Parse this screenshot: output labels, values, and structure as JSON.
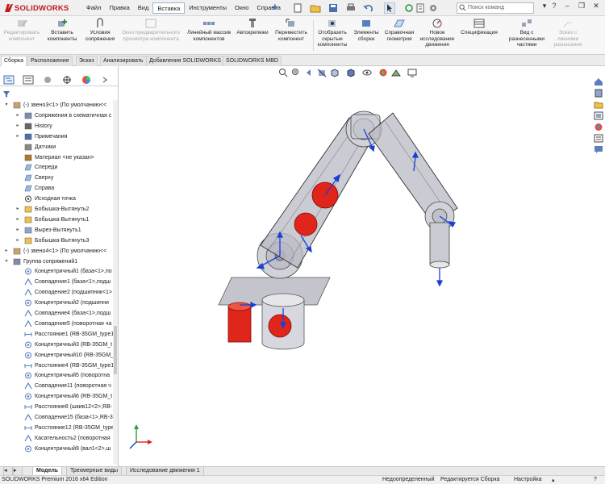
{
  "app": {
    "logo_text": "SOLIDWORKS",
    "brand_color": "#c0181f",
    "menu": [
      "Файл",
      "Правка",
      "Вид",
      "Вставка",
      "Инструменты",
      "Окно",
      "Справка"
    ],
    "active_menu": "Вставка",
    "search_placeholder": "Поиск команд"
  },
  "ribbon": {
    "buttons": [
      {
        "label": "Редактировать компонент",
        "disabled": true
      },
      {
        "label": "Вставить компоненты",
        "disabled": false
      },
      {
        "label": "Условия сопряжения",
        "disabled": false
      },
      {
        "label": "Окно предварительного просмотра компонента",
        "disabled": true
      },
      {
        "label": "Линейный массив компонентов",
        "disabled": false
      },
      {
        "label": "Автокрепежи",
        "disabled": false
      },
      {
        "label": "Переместить компонент",
        "disabled": false
      },
      {
        "label": "Отобразить скрытые компоненты",
        "disabled": false
      },
      {
        "label": "Элементы сборки",
        "disabled": false
      },
      {
        "label": "Справочная геометрия",
        "disabled": false
      },
      {
        "label": "Новое исследование движения",
        "disabled": false
      },
      {
        "label": "Спецификация",
        "disabled": false
      },
      {
        "label": "Вид с разнесенными частями",
        "disabled": false
      },
      {
        "label": "Эскиз с линиями разнесения",
        "disabled": true
      }
    ]
  },
  "command_tabs": [
    "Сборка",
    "Расположение",
    "Эскиз",
    "Анализировать",
    "Добавления SOLIDWORKS",
    "SOLIDWORKS MBD"
  ],
  "active_command_tab": "Сборка",
  "tree": {
    "items": [
      {
        "label": "(-) звено3<1> (По умолчанию<<",
        "icon": "part-icon",
        "indent": 0,
        "expander": "▾"
      },
      {
        "label": "Сопряжения в схематичная с",
        "icon": "mates-icon",
        "indent": 1,
        "expander": "▸"
      },
      {
        "label": "History",
        "icon": "history-icon",
        "indent": 1,
        "expander": "▸"
      },
      {
        "label": "Примечания",
        "icon": "annotations-icon",
        "indent": 1,
        "expander": "▸"
      },
      {
        "label": "Датчики",
        "icon": "sensors-icon",
        "indent": 1,
        "expander": ""
      },
      {
        "label": "Материал <не указан>",
        "icon": "material-icon",
        "indent": 1,
        "expander": ""
      },
      {
        "label": "Спереди",
        "icon": "plane-icon",
        "indent": 1,
        "expander": ""
      },
      {
        "label": "Сверху",
        "icon": "plane-icon",
        "indent": 1,
        "expander": ""
      },
      {
        "label": "Справа",
        "icon": "plane-icon",
        "indent": 1,
        "expander": ""
      },
      {
        "label": "Исходная точка",
        "icon": "origin-icon",
        "indent": 1,
        "expander": ""
      },
      {
        "label": "Бобышка-Вытянуть2",
        "icon": "extrude-icon",
        "indent": 1,
        "expander": "▸"
      },
      {
        "label": "Бобышка-Вытянуть1",
        "icon": "extrude-icon",
        "indent": 1,
        "expander": "▸"
      },
      {
        "label": "Вырез-Вытянуть1",
        "icon": "cut-icon",
        "indent": 1,
        "expander": "▸"
      },
      {
        "label": "Бобышка-Вытянуть3",
        "icon": "extrude-icon",
        "indent": 1,
        "expander": "▸"
      },
      {
        "label": "(-) звено4<1> (По умолчанию<<",
        "icon": "part-icon",
        "indent": 0,
        "expander": "▸"
      },
      {
        "label": "Группа сопряжений1",
        "icon": "mategroup-icon",
        "indent": 0,
        "expander": "▾"
      },
      {
        "label": "Концентричный1 (база<1>,по",
        "icon": "concentric-icon",
        "indent": 1,
        "expander": ""
      },
      {
        "label": "Совпадение1 (база<1>,подш",
        "icon": "coincident-icon",
        "indent": 1,
        "expander": ""
      },
      {
        "label": "Совпадение2 (подшипник<1>",
        "icon": "coincident-icon",
        "indent": 1,
        "expander": ""
      },
      {
        "label": "Концентричный2 (подшипни",
        "icon": "concentric-icon",
        "indent": 1,
        "expander": ""
      },
      {
        "label": "Совпадение4 (база<1>,подш",
        "icon": "coincident-icon",
        "indent": 1,
        "expander": ""
      },
      {
        "label": "Совпадение5 (поворотная ча",
        "icon": "coincident-icon",
        "indent": 1,
        "expander": ""
      },
      {
        "label": "Расстояние1 (RB-35GM_type1",
        "icon": "distance-icon",
        "indent": 1,
        "expander": ""
      },
      {
        "label": "Концентричный3 (RB-35GM_t",
        "icon": "concentric-icon",
        "indent": 1,
        "expander": ""
      },
      {
        "label": "Концентричный10 (RB-35GM_type",
        "icon": "concentric-icon",
        "indent": 1,
        "expander": ""
      },
      {
        "label": "Расстояние4 (RB-35GM_type1",
        "icon": "distance-icon",
        "indent": 1,
        "expander": ""
      },
      {
        "label": "Концентричный5 (поворотна",
        "icon": "concentric-icon",
        "indent": 1,
        "expander": ""
      },
      {
        "label": "Совпадение11 (поворотная ч",
        "icon": "coincident-icon",
        "indent": 1,
        "expander": ""
      },
      {
        "label": "Концентричный6 (RB-35GM_t",
        "icon": "concentric-icon",
        "indent": 1,
        "expander": ""
      },
      {
        "label": "Расстояние8 (шкив12<2>,RB-",
        "icon": "distance-icon",
        "indent": 1,
        "expander": ""
      },
      {
        "label": "Совпадение15 (база<1>,RB-3",
        "icon": "coincident-icon",
        "indent": 1,
        "expander": ""
      },
      {
        "label": "Расстояние12 (RB-35GM_type",
        "icon": "distance-icon",
        "indent": 1,
        "expander": ""
      },
      {
        "label": "Касательность2 (поворотная",
        "icon": "tangent-icon",
        "indent": 1,
        "expander": ""
      },
      {
        "label": "Концентричный9 (вал1<2>,ш",
        "icon": "concentric-icon",
        "indent": 1,
        "expander": ""
      }
    ]
  },
  "bottom_tabs": [
    "Модель",
    "Трехмерные виды",
    "Исследование движения 1"
  ],
  "active_bottom_tab": "Модель",
  "status": {
    "edition": "SOLIDWORKS Premium 2016 x64 Edition",
    "definition": "Недоопределенный",
    "editing": "Редактируется Сборка",
    "settings": "Настройка"
  },
  "colors": {
    "highlight_red": "#e0251b",
    "mate_blue": "#1b3fd6",
    "part_gray": "#b9b9c4"
  }
}
